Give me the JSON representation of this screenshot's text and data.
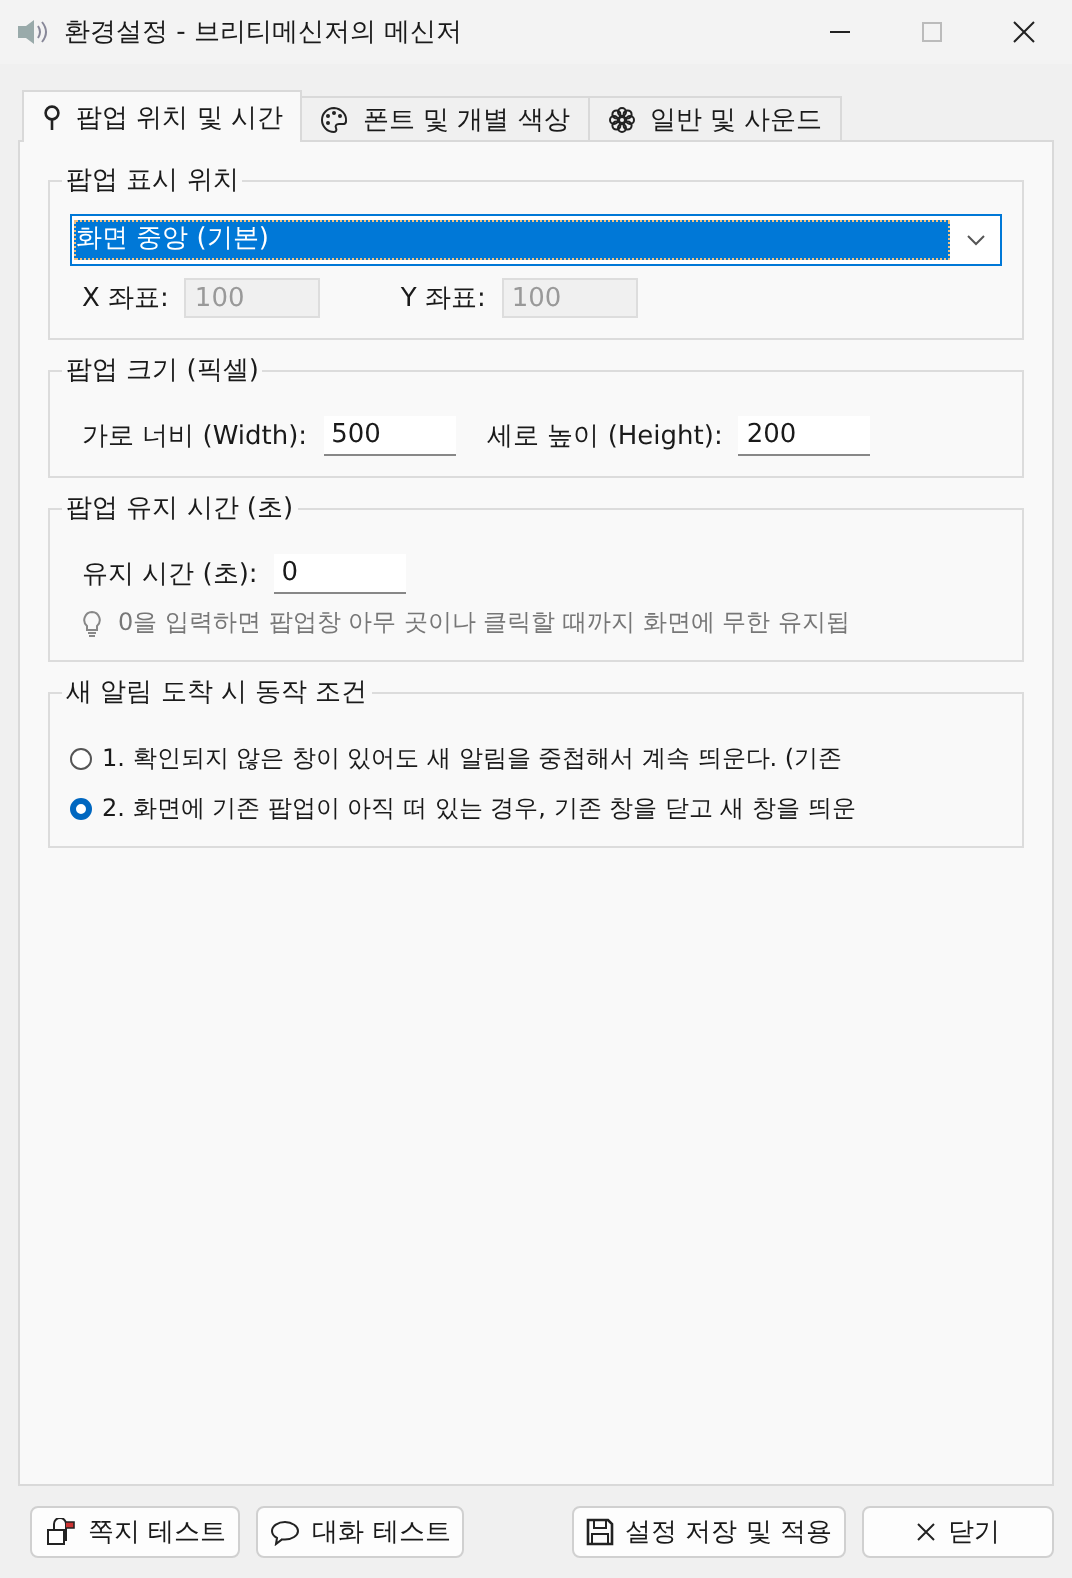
{
  "window": {
    "title": "환경설정 - 브리티메신저의 메신저"
  },
  "tabs": [
    {
      "label": "팝업 위치 및 시간",
      "kind": "pin",
      "selected": true
    },
    {
      "label": "폰트 및 개별 색상",
      "kind": "palette",
      "selected": false
    },
    {
      "label": "일반 및 사운드",
      "kind": "gear",
      "selected": false
    }
  ],
  "position_group": {
    "title": "팝업 표시 위치",
    "dropdown": {
      "value": "화면 중앙 (기본)"
    },
    "x_label": "X 좌표:",
    "x_value": "100",
    "y_label": "Y 좌표:",
    "y_value": "100",
    "coords_disabled": true
  },
  "size_group": {
    "title": "팝업 크기 (픽셀)",
    "width_label": "가로 너비 (Width):",
    "width_value": "500",
    "height_label": "세로 높이 (Height):",
    "height_value": "200"
  },
  "duration_group": {
    "title": "팝업 유지 시간 (초)",
    "label": "유지 시간 (초):",
    "value": "0",
    "hint": "0을 입력하면 팝업창 아무 곳이나 클릭할 때까지 화면에 무한 유지됩"
  },
  "behavior_group": {
    "title": "새 알림 도착 시 동작 조건",
    "options": [
      {
        "label": "1. 확인되지 않은 창이 있어도 새 알림을 중첩해서 계속 띄운다. (기존",
        "selected": false
      },
      {
        "label": "2. 화면에 기존 팝업이 아직 떠 있는 경우, 기존 창을 닫고 새 창을 띄운",
        "selected": true
      }
    ]
  },
  "buttons": [
    {
      "label": "쪽지 테스트",
      "kind": "mailbox"
    },
    {
      "label": "대화 테스트",
      "kind": "bubble"
    },
    {
      "label": "설정 저장 및 적용",
      "kind": "save"
    },
    {
      "label": "닫기",
      "kind": "close"
    }
  ]
}
